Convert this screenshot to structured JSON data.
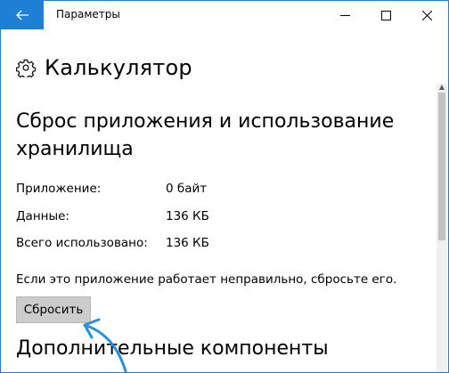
{
  "window": {
    "title": "Параметры",
    "accent": "#1e7fd4"
  },
  "app": {
    "title": "Калькулятор",
    "icon": "gear-icon"
  },
  "reset_section": {
    "title": "Сброс приложения и использование хранилища",
    "rows": [
      {
        "label": "Приложение:",
        "value": "0 байт"
      },
      {
        "label": "Данные:",
        "value": "136 КБ"
      },
      {
        "label": "Всего использовано:",
        "value": "136 КБ"
      }
    ],
    "hint": "Если это приложение работает неправильно, сбросьте его.",
    "button_label": "Сбросить"
  },
  "extras_section": {
    "title": "Дополнительные компоненты"
  }
}
